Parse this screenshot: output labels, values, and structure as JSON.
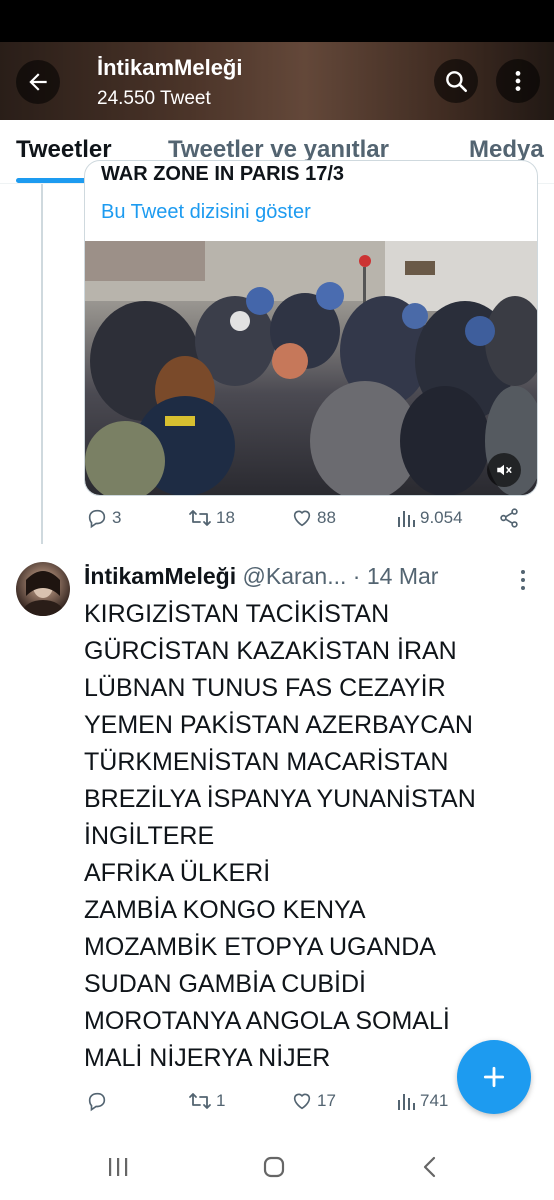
{
  "header": {
    "name": "İntikamMeleği",
    "tweet_count": "24.550 Tweet"
  },
  "tabs": [
    {
      "label": "Tweetler",
      "active": true
    },
    {
      "label": "Tweetler ve yanıtlar",
      "active": false
    },
    {
      "label": "Medya",
      "active": false
    }
  ],
  "quoted_tweet": {
    "clipped_text": "WAR ZONE IN PARIS 17/3",
    "show_thread_label": "Bu Tweet dizisini göster",
    "stats": {
      "replies": "3",
      "retweets": "18",
      "likes": "88",
      "views": "9.054"
    }
  },
  "tweet": {
    "name": "İntikamMeleği",
    "handle": "@Karan...",
    "date": "· 14 Mar",
    "lines": [
      "KIRGIZİSTAN TACİKİSTAN",
      "GÜRCİSTAN KAZAKİSTAN İRAN",
      "LÜBNAN TUNUS FAS CEZAYİR",
      "YEMEN PAKİSTAN AZERBAYCAN",
      "TÜRKMENİSTAN MACARİSTAN",
      "BREZİLYA İSPANYA YUNANİSTAN",
      "İNGİLTERE",
      "AFRİKA ÜLKERİ",
      "ZAMBİA KONGO KENYA",
      "MOZAMBİK ETOPYA UGANDA",
      "SUDAN GAMBİA CUBİDİ",
      "MOROTANYA ANGOLA SOMALİ",
      "MALİ NİJERYA NİJER"
    ],
    "stats": {
      "replies": "",
      "retweets": "1",
      "likes": "17",
      "views": "741"
    }
  },
  "colors": {
    "accent": "#1d9bf0",
    "text": "#0f1419",
    "muted": "#536471"
  }
}
